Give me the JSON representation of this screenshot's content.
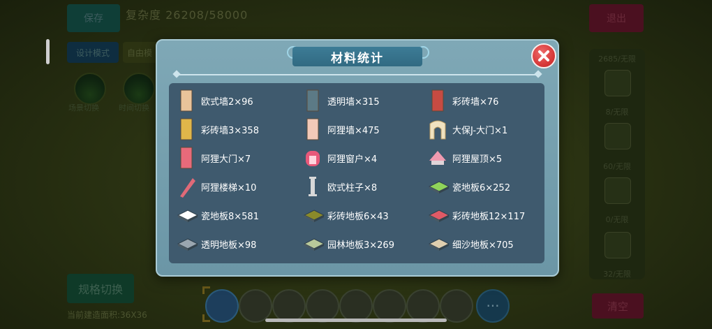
{
  "hud": {
    "save": "保存",
    "complexity": "复杂度 26208/58000",
    "exit": "退出",
    "design_mode": "设计模式",
    "mode_value": "自由模",
    "scene_switch": "场景切换",
    "scene_switch_2": "时间切换",
    "spec_switch": "规格切换",
    "area": "当前建造面积:36X36",
    "clear": "清空",
    "right_counts": [
      "2685/无限",
      "8/无限",
      "60/无限",
      "0/无限",
      "32/无限"
    ],
    "more": "···"
  },
  "modal": {
    "title": "材料统计",
    "items": [
      {
        "label": "欧式墙2×96",
        "icon": "wall-panel-icon",
        "color": "#e9c39a"
      },
      {
        "label": "透明墙×315",
        "icon": "glass-wall-icon",
        "color": "#5c7a86"
      },
      {
        "label": "彩砖墙×76",
        "icon": "brick-wall-icon",
        "color": "#c74b42"
      },
      {
        "label": "彩砖墙3×358",
        "icon": "brick-wall-yellow-icon",
        "color": "#e0b64a"
      },
      {
        "label": "阿狸墙×475",
        "icon": "ali-wall-icon",
        "color": "#f2c9b8"
      },
      {
        "label": "大保J-大门×1",
        "icon": "arch-gate-icon",
        "color": "#f0e2c0"
      },
      {
        "label": "阿狸大门×7",
        "icon": "ali-door-icon",
        "color": "#e86a7a"
      },
      {
        "label": "阿狸窗户×4",
        "icon": "ali-window-icon",
        "color": "#e8587a"
      },
      {
        "label": "阿狸屋顶×5",
        "icon": "ali-roof-icon",
        "color": "#f09ab0"
      },
      {
        "label": "阿狸楼梯×10",
        "icon": "ali-stairs-icon",
        "color": "#e06a78"
      },
      {
        "label": "欧式柱子×8",
        "icon": "column-icon",
        "color": "#d8d8d8"
      },
      {
        "label": "瓷地板6×252",
        "icon": "tile-green-icon",
        "color": "#8fd45a"
      },
      {
        "label": "瓷地板8×581",
        "icon": "tile-white-icon",
        "color": "#ffffff"
      },
      {
        "label": "彩砖地板6×43",
        "icon": "tile-olive-icon",
        "color": "#8a8a2a"
      },
      {
        "label": "彩砖地板12×117",
        "icon": "tile-red-icon",
        "color": "#e05a66"
      },
      {
        "label": "透明地板×98",
        "icon": "tile-glass-icon",
        "color": "#9aa6b0"
      },
      {
        "label": "园林地板3×269",
        "icon": "tile-garden-icon",
        "color": "#b8c89a"
      },
      {
        "label": "细沙地板×705",
        "icon": "tile-sand-icon",
        "color": "#e0cfaf"
      }
    ]
  }
}
